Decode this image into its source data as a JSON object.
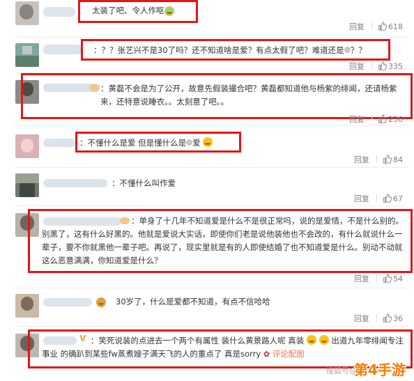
{
  "comments": [
    {
      "text": "太装了吧、令人作呕",
      "likes": "618",
      "reply": "回复",
      "emoji": "vomit-face"
    },
    {
      "text_a": "：？？张艺兴不是30了吗？还不知道啥是爱？有点太假了吧？难道还是",
      "text_b": "？？",
      "likes": "335",
      "reply": "回复"
    },
    {
      "text": "：黄磊不会是为了公开，故意先假装撮合吧？黄磊都知道他与杨紫的绯闻，还请杨紫来，还特意说睡衣。。太刻意了吧。。",
      "likes": "236",
      "reply": "回复"
    },
    {
      "text_a": "：不懂什么是爱 但是懂什么是",
      "text_b": "爱",
      "likes": "84",
      "reply": "回复",
      "emoji": "grin-face"
    },
    {
      "text": "：不懂什么叫作爱",
      "likes": "67",
      "reply": "回复"
    },
    {
      "text": "：单身了十几年不知道爱是什么不是很正常吗，说的是爱情，不是什么别的。别黑了，这有什么好黑的。他就是爱说大实话，即使你们老是说他装他也不会改的，有什么就说什么一辈子，要不你就黑他一辈子吧。再说了，现实里就是有的人即使结婚了也不知道爱是什么。别动不动就这么恶意满满，你知道爱是什么？",
      "likes": "54",
      "reply": "回复"
    },
    {
      "text": "30岁了，什么是爱都不知道，有点不信哈哈",
      "likes": "36",
      "reply": "回复"
    },
    {
      "text_a": "：笑死说装的点进去一个两个有属性 装什么黄景路人呢 真装",
      "text_b": "出道九年零绯闻专注事业 的确趴到某些fw蒸煮嫂子满天飞的人的重点了 真是sorry",
      "text_c": "评论配图",
      "emoji": "grin-face"
    }
  ],
  "watermark": {
    "source": "搜狐号@",
    "brand": "第4手游"
  },
  "colors": {
    "highlight_box": "#e31515",
    "meta_text": "#808080",
    "link": "#eb7350"
  }
}
